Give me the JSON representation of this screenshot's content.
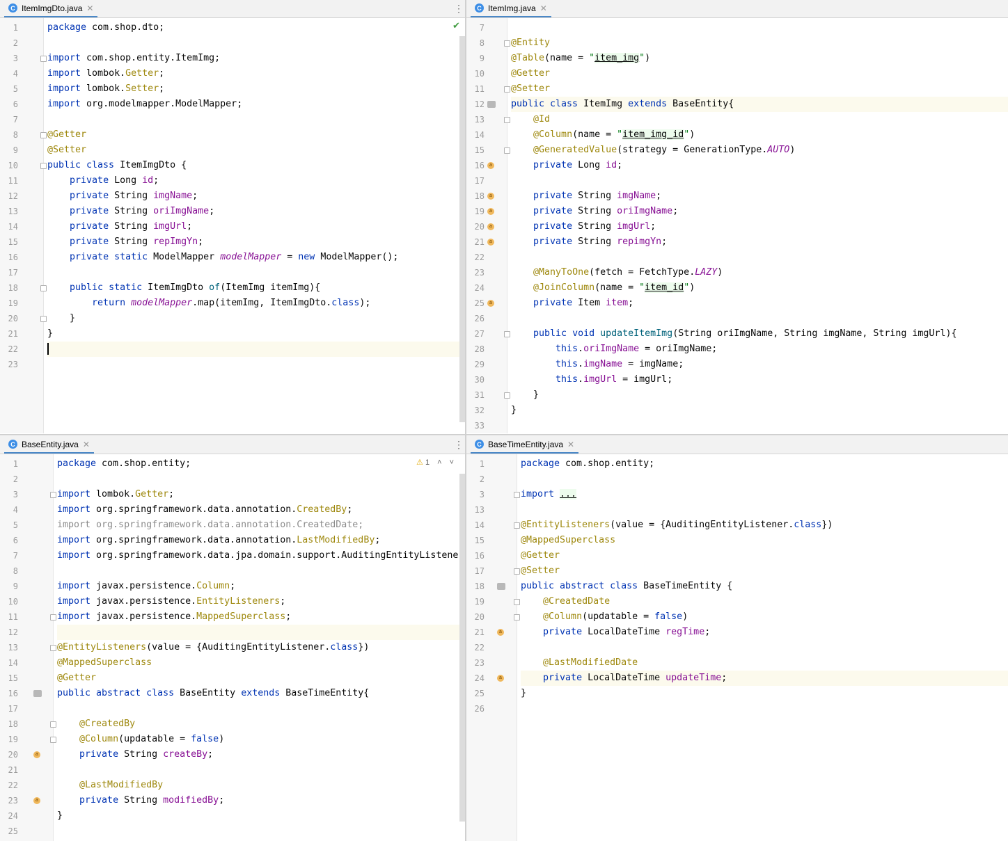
{
  "panes": {
    "tl": {
      "tab": "ItemImgDto.java",
      "tab_icon": "class-icon",
      "first_line": 1,
      "lines": [
        [
          [
            "kw",
            "package "
          ],
          [
            "",
            "com.shop.dto;"
          ]
        ],
        [],
        [
          [
            "kw",
            "import "
          ],
          [
            "",
            "com.shop.entity.ItemImg;"
          ]
        ],
        [
          [
            "kw",
            "import "
          ],
          [
            "",
            "lombok."
          ],
          [
            "an",
            "Getter"
          ],
          [
            "",
            ";"
          ]
        ],
        [
          [
            "kw",
            "import "
          ],
          [
            "",
            "lombok."
          ],
          [
            "an",
            "Setter"
          ],
          [
            "",
            ";"
          ]
        ],
        [
          [
            "kw",
            "import "
          ],
          [
            "",
            "org.modelmapper.ModelMapper;"
          ]
        ],
        [],
        [
          [
            "an",
            "@Getter"
          ]
        ],
        [
          [
            "an",
            "@Setter"
          ]
        ],
        [
          [
            "kw",
            "public class "
          ],
          [
            "",
            "ItemImgDto {"
          ]
        ],
        [
          [
            "",
            "    "
          ],
          [
            "kw",
            "private "
          ],
          [
            "",
            "Long "
          ],
          [
            "fd",
            "id"
          ],
          [
            "",
            ";"
          ]
        ],
        [
          [
            "",
            "    "
          ],
          [
            "kw",
            "private "
          ],
          [
            "",
            "String "
          ],
          [
            "fd",
            "imgName"
          ],
          [
            "",
            ";"
          ]
        ],
        [
          [
            "",
            "    "
          ],
          [
            "kw",
            "private "
          ],
          [
            "",
            "String "
          ],
          [
            "fd",
            "oriImgName"
          ],
          [
            "",
            ";"
          ]
        ],
        [
          [
            "",
            "    "
          ],
          [
            "kw",
            "private "
          ],
          [
            "",
            "String "
          ],
          [
            "fd",
            "imgUrl"
          ],
          [
            "",
            ";"
          ]
        ],
        [
          [
            "",
            "    "
          ],
          [
            "kw",
            "private "
          ],
          [
            "",
            "String "
          ],
          [
            "fd",
            "repImgYn"
          ],
          [
            "",
            ";"
          ]
        ],
        [
          [
            "",
            "    "
          ],
          [
            "kw",
            "private static "
          ],
          [
            "",
            "ModelMapper "
          ],
          [
            "it",
            "modelMapper"
          ],
          [
            "",
            " = "
          ],
          [
            "kw",
            "new "
          ],
          [
            "",
            "ModelMapper();"
          ]
        ],
        [],
        [
          [
            "",
            "    "
          ],
          [
            "kw",
            "public static "
          ],
          [
            "",
            "ItemImgDto "
          ],
          [
            "mc",
            "of"
          ],
          [
            "",
            "(ItemImg itemImg){"
          ]
        ],
        [
          [
            "",
            "        "
          ],
          [
            "kw",
            "return "
          ],
          [
            "it",
            "modelMapper"
          ],
          [
            "",
            ".map(itemImg, ItemImgDto."
          ],
          [
            "kw",
            "class"
          ],
          [
            "",
            ");"
          ]
        ],
        [
          [
            "",
            "    }"
          ]
        ],
        [
          [
            "",
            "}"
          ]
        ],
        [],
        []
      ]
    },
    "tr": {
      "tab": "ItemImg.java",
      "tab_icon": "class-icon",
      "first_line": 7,
      "lines": [
        [],
        [
          [
            "an",
            "@Entity"
          ]
        ],
        [
          [
            "an",
            "@Table"
          ],
          [
            "",
            "(name = "
          ],
          [
            "st",
            "\""
          ],
          [
            "sh",
            "item_img"
          ],
          [
            "st",
            "\""
          ],
          [
            "",
            ")"
          ]
        ],
        [
          [
            "an",
            "@Getter"
          ]
        ],
        [
          [
            "an",
            "@Setter"
          ]
        ],
        [
          [
            "kw",
            "public class "
          ],
          [
            "",
            "ItemImg "
          ],
          [
            "kw",
            "extends "
          ],
          [
            "",
            "BaseEntity{"
          ]
        ],
        [
          [
            "",
            "    "
          ],
          [
            "an",
            "@Id"
          ]
        ],
        [
          [
            "",
            "    "
          ],
          [
            "an",
            "@Column"
          ],
          [
            "",
            "(name = "
          ],
          [
            "st",
            "\""
          ],
          [
            "sh",
            "item_img_id"
          ],
          [
            "st",
            "\""
          ],
          [
            "",
            ")"
          ]
        ],
        [
          [
            "",
            "    "
          ],
          [
            "an",
            "@GeneratedValue"
          ],
          [
            "",
            "(strategy = GenerationType."
          ],
          [
            "it",
            "AUTO"
          ],
          [
            "",
            ")"
          ]
        ],
        [
          [
            "",
            "    "
          ],
          [
            "kw",
            "private "
          ],
          [
            "",
            "Long "
          ],
          [
            "fd",
            "id"
          ],
          [
            "",
            ";"
          ]
        ],
        [],
        [
          [
            "",
            "    "
          ],
          [
            "kw",
            "private "
          ],
          [
            "",
            "String "
          ],
          [
            "fd",
            "imgName"
          ],
          [
            "",
            ";"
          ]
        ],
        [
          [
            "",
            "    "
          ],
          [
            "kw",
            "private "
          ],
          [
            "",
            "String "
          ],
          [
            "fd",
            "oriImgName"
          ],
          [
            "",
            ";"
          ]
        ],
        [
          [
            "",
            "    "
          ],
          [
            "kw",
            "private "
          ],
          [
            "",
            "String "
          ],
          [
            "fd",
            "imgUrl"
          ],
          [
            "",
            ";"
          ]
        ],
        [
          [
            "",
            "    "
          ],
          [
            "kw",
            "private "
          ],
          [
            "",
            "String "
          ],
          [
            "fd",
            "repimgYn"
          ],
          [
            "",
            ";"
          ]
        ],
        [],
        [
          [
            "",
            "    "
          ],
          [
            "an",
            "@ManyToOne"
          ],
          [
            "",
            "(fetch = FetchType."
          ],
          [
            "it",
            "LAZY"
          ],
          [
            "",
            ")"
          ]
        ],
        [
          [
            "",
            "    "
          ],
          [
            "an",
            "@JoinColumn"
          ],
          [
            "",
            "(name = "
          ],
          [
            "st",
            "\""
          ],
          [
            "sh",
            "item_id"
          ],
          [
            "st",
            "\""
          ],
          [
            "",
            ")"
          ]
        ],
        [
          [
            "",
            "    "
          ],
          [
            "kw",
            "private "
          ],
          [
            "",
            "Item "
          ],
          [
            "fd",
            "item"
          ],
          [
            "",
            ";"
          ]
        ],
        [],
        [
          [
            "",
            "    "
          ],
          [
            "kw",
            "public void "
          ],
          [
            "mc",
            "updateItemImg"
          ],
          [
            "",
            "(String oriImgName, String imgName, String imgUrl){"
          ]
        ],
        [
          [
            "",
            "        "
          ],
          [
            "kw",
            "this"
          ],
          [
            "",
            "."
          ],
          [
            "fd",
            "oriImgName"
          ],
          [
            "",
            " = oriImgName;"
          ]
        ],
        [
          [
            "",
            "        "
          ],
          [
            "kw",
            "this"
          ],
          [
            "",
            "."
          ],
          [
            "fd",
            "imgName"
          ],
          [
            "",
            " = imgName;"
          ]
        ],
        [
          [
            "",
            "        "
          ],
          [
            "kw",
            "this"
          ],
          [
            "",
            "."
          ],
          [
            "fd",
            "imgUrl"
          ],
          [
            "",
            " = imgUrl;"
          ]
        ],
        [
          [
            "",
            "    }"
          ]
        ],
        [
          [
            "",
            "}"
          ]
        ],
        []
      ]
    },
    "bl": {
      "tab": "BaseEntity.java",
      "tab_icon": "class-icon",
      "first_line": 1,
      "warning_count": "1",
      "lines": [
        [
          [
            "kw",
            "package "
          ],
          [
            "",
            "com.shop.entity;"
          ]
        ],
        [],
        [
          [
            "kw",
            "import "
          ],
          [
            "",
            "lombok."
          ],
          [
            "an",
            "Getter"
          ],
          [
            "",
            ";"
          ]
        ],
        [
          [
            "kw",
            "import "
          ],
          [
            "",
            "org.springframework.data.annotation."
          ],
          [
            "an",
            "CreatedBy"
          ],
          [
            "",
            ";"
          ]
        ],
        [
          [
            "gr",
            "import org.springframework.data.annotation.CreatedDate;"
          ]
        ],
        [
          [
            "kw",
            "import "
          ],
          [
            "",
            "org.springframework.data.annotation."
          ],
          [
            "an",
            "LastModifiedBy"
          ],
          [
            "",
            ";"
          ]
        ],
        [
          [
            "kw",
            "import "
          ],
          [
            "",
            "org.springframework.data.jpa.domain.support.AuditingEntityListener;"
          ]
        ],
        [],
        [
          [
            "kw",
            "import "
          ],
          [
            "",
            "javax.persistence."
          ],
          [
            "an",
            "Column"
          ],
          [
            "",
            ";"
          ]
        ],
        [
          [
            "kw",
            "import "
          ],
          [
            "",
            "javax.persistence."
          ],
          [
            "an",
            "EntityListeners"
          ],
          [
            "",
            ";"
          ]
        ],
        [
          [
            "kw",
            "import "
          ],
          [
            "",
            "javax.persistence."
          ],
          [
            "an",
            "MappedSuperclass"
          ],
          [
            "",
            ";"
          ]
        ],
        [],
        [
          [
            "an",
            "@EntityListeners"
          ],
          [
            "",
            "(value = {AuditingEntityListener."
          ],
          [
            "kw",
            "class"
          ],
          [
            "",
            "})"
          ]
        ],
        [
          [
            "an",
            "@MappedSuperclass"
          ]
        ],
        [
          [
            "an",
            "@Getter"
          ]
        ],
        [
          [
            "kw",
            "public abstract class "
          ],
          [
            "",
            "BaseEntity "
          ],
          [
            "kw",
            "extends "
          ],
          [
            "",
            "BaseTimeEntity{"
          ]
        ],
        [],
        [
          [
            "",
            "    "
          ],
          [
            "an",
            "@CreatedBy"
          ]
        ],
        [
          [
            "",
            "    "
          ],
          [
            "an",
            "@Column"
          ],
          [
            "",
            "(updatable = "
          ],
          [
            "kw",
            "false"
          ],
          [
            "",
            ")"
          ]
        ],
        [
          [
            "",
            "    "
          ],
          [
            "kw",
            "private "
          ],
          [
            "",
            "String "
          ],
          [
            "fd",
            "createBy"
          ],
          [
            "",
            ";"
          ]
        ],
        [],
        [
          [
            "",
            "    "
          ],
          [
            "an",
            "@LastModifiedBy"
          ]
        ],
        [
          [
            "",
            "    "
          ],
          [
            "kw",
            "private "
          ],
          [
            "",
            "String "
          ],
          [
            "fd",
            "modifiedBy"
          ],
          [
            "",
            ";"
          ]
        ],
        [
          [
            "",
            "}"
          ]
        ],
        []
      ]
    },
    "br": {
      "tab": "BaseTimeEntity.java",
      "tab_icon": "class-icon",
      "line_numbers": [
        1,
        2,
        3,
        13,
        14,
        15,
        16,
        17,
        18,
        19,
        20,
        21,
        22,
        23,
        24,
        25,
        26
      ],
      "lines": [
        [
          [
            "kw",
            "package "
          ],
          [
            "",
            "com.shop.entity;"
          ]
        ],
        [],
        [
          [
            "kw",
            "import "
          ],
          [
            "sh",
            "..."
          ]
        ],
        [],
        [
          [
            "an",
            "@EntityListeners"
          ],
          [
            "",
            "(value = {AuditingEntityListener."
          ],
          [
            "kw",
            "class"
          ],
          [
            "",
            "})"
          ]
        ],
        [
          [
            "an",
            "@MappedSuperclass"
          ]
        ],
        [
          [
            "an",
            "@Getter"
          ]
        ],
        [
          [
            "an",
            "@Setter"
          ]
        ],
        [
          [
            "kw",
            "public abstract class "
          ],
          [
            "",
            "BaseTimeEntity {"
          ]
        ],
        [
          [
            "",
            "    "
          ],
          [
            "an",
            "@CreatedDate"
          ]
        ],
        [
          [
            "",
            "    "
          ],
          [
            "an",
            "@Column"
          ],
          [
            "",
            "(updatable = "
          ],
          [
            "kw",
            "false"
          ],
          [
            "",
            ")"
          ]
        ],
        [
          [
            "",
            "    "
          ],
          [
            "kw",
            "private "
          ],
          [
            "",
            "LocalDateTime "
          ],
          [
            "fd",
            "regTime"
          ],
          [
            "",
            ";"
          ]
        ],
        [],
        [
          [
            "",
            "    "
          ],
          [
            "an",
            "@LastModifiedDate"
          ]
        ],
        [
          [
            "",
            "    "
          ],
          [
            "kw",
            "private "
          ],
          [
            "",
            "LocalDateTime "
          ],
          [
            "fd",
            "updateTime"
          ],
          [
            "",
            ";"
          ]
        ],
        [
          [
            "",
            "}"
          ]
        ],
        []
      ]
    }
  },
  "icons": {
    "tab": "class-icon",
    "menu": "kebab-menu-icon",
    "close": "close-icon",
    "status_ok": "check-icon",
    "warning": "warning-icon",
    "field_gutter": "field-annotation-icon",
    "db_gutter": "database-icon"
  },
  "colors": {
    "keyword": "#0033b3",
    "annotation": "#9e880d",
    "string": "#067d17",
    "field": "#871094",
    "method": "#00627a",
    "tab_accent": "#4a88c7"
  }
}
